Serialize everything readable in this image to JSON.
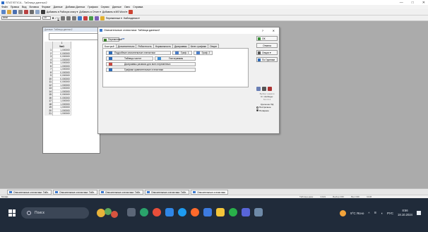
{
  "window": {
    "title": "STATISTICA - Таблица данных2",
    "min": "—",
    "max": "□",
    "close": "✕"
  },
  "menubar": {
    "items": [
      "Файл",
      "Правка",
      "Вид",
      "Вставка",
      "Формат",
      "Данные",
      "Добавки Данных",
      "Графики",
      "Сервис",
      "Данные",
      "Окно",
      "Справка"
    ]
  },
  "toolbar": {
    "btn_add_workbook": "Добавить в Рабочую книгу ▾",
    "btn_add_report": "Добавить в Отчет ▾",
    "btn_add_word": "Добавить в MS Word ▾",
    "font_name": "Arial",
    "font_size": "10",
    "var_label": "Переменные ▾",
    "obs_label": "Наблюдения ▾"
  },
  "sheet": {
    "title": "Данные: Таблица данных2",
    "col_header": "1",
    "col_name": "Var1",
    "rows": [
      {
        "n": "1",
        "v": "1,000000"
      },
      {
        "n": "2",
        "v": "0,000000"
      },
      {
        "n": "3",
        "v": "0,000000"
      },
      {
        "n": "4",
        "v": "1,000000"
      },
      {
        "n": "5",
        "v": "1,000000"
      },
      {
        "n": "6",
        "v": "1,000000"
      },
      {
        "n": "7",
        "v": "1,000000"
      },
      {
        "n": "8",
        "v": "0,000000"
      },
      {
        "n": "9",
        "v": "0,000000"
      },
      {
        "n": "10",
        "v": "0,000000"
      },
      {
        "n": "11",
        "v": "0,000000"
      },
      {
        "n": "12",
        "v": "1,000000"
      },
      {
        "n": "13",
        "v": "1,000000"
      },
      {
        "n": "14",
        "v": "1,000000"
      },
      {
        "n": "15",
        "v": "0,000000"
      },
      {
        "n": "16",
        "v": "0,000000"
      },
      {
        "n": "17",
        "v": "1,000000"
      },
      {
        "n": "18",
        "v": "1,000000"
      },
      {
        "n": "19",
        "v": "1,000000"
      },
      {
        "n": "20",
        "v": "1,000000"
      },
      {
        "n": "21",
        "v": "1,000000"
      }
    ]
  },
  "dialog": {
    "title": "Описательные статистики: Таблица данных2",
    "help": "?",
    "close": "✕",
    "variables_btn": "Переменные",
    "variables_sel": "var",
    "tabs": [
      "Быстрый",
      "Дополнительно",
      "Робастность",
      "Нормальность",
      "Диаграммы",
      "Катег. графики",
      "Опции"
    ],
    "btn_detailed": "Подробные описательные статистики",
    "btn_graph1": "Граф. 1",
    "btn_graph2": "Граф. 2",
    "btn_freq": "Таблицы частот",
    "btn_hist": "Гистограммы",
    "btn_scatter_all": "Диаграммы размаха для всех переменных",
    "btn_compare": "Графики сравнительные статистики",
    "btn_ok": "ОК",
    "btn_cancel": "Отмена",
    "btn_options": "Опции ▾",
    "btn_by_group": "По Группам",
    "sel_label1": "Выбор: нажати",
    "sel_label2": "Ст. свободы:",
    "sel_label3": "N-1     N-1",
    "mv_label": "Удаление ПД",
    "radio1": "Построчное",
    "radio2": "Попарное"
  },
  "doctabs": [
    "Описательные статистики: Табл.",
    "Описательные статистики: Табл.",
    "Описательные статистики: Табл.",
    "Описательные статистики: Табл.",
    "Описательные статистики"
  ],
  "status": {
    "ready": "Готово",
    "cell": "Таблица данн",
    "addr": "V1/21",
    "buf": "Выбор OFF",
    "weight": "Вес OFF",
    "num": "NUM"
  },
  "taskbar": {
    "search": "Поиск",
    "weather": "9°C Ясно",
    "lang": "РУС",
    "time": "8:56",
    "date": "18.10.2024"
  }
}
